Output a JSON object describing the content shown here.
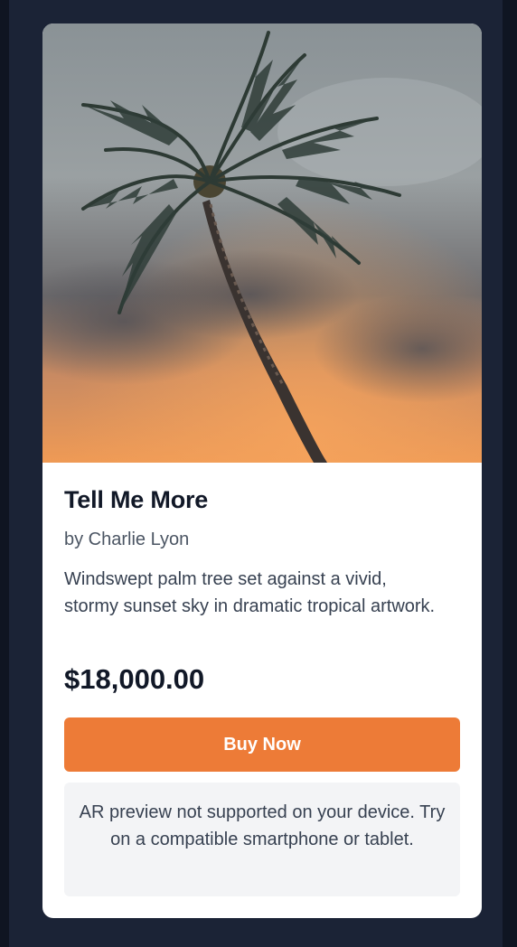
{
  "product": {
    "image_alt": "palm tree against stormy sunset sky",
    "title": "Tell Me More",
    "artist": "by Charlie Lyon",
    "description": "Windswept palm tree set against a vivid, stormy sunset sky in dramatic tropical artwork.",
    "price": "$18,000.00"
  },
  "actions": {
    "buy_label": "Buy Now"
  },
  "ar_notice": {
    "text": "AR preview not supported on your device. Try on a compatible smartphone or tablet."
  },
  "colors": {
    "page_bg": "#0f1522",
    "frame_bg": "#1b2336",
    "card_bg": "#ffffff",
    "accent": "#ed7b37",
    "notice_bg": "#f3f4f6"
  }
}
